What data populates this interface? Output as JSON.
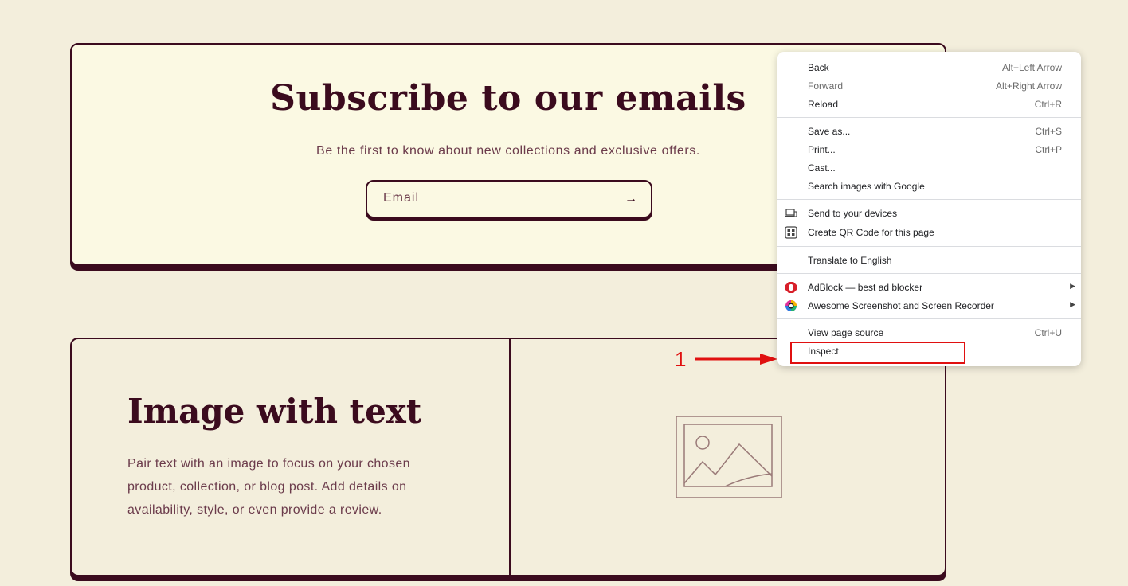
{
  "subscribe": {
    "title": "Subscribe to our emails",
    "subtitle": "Be the first to know about new collections and exclusive offers.",
    "email_placeholder": "Email",
    "submit_icon": "→"
  },
  "image_with_text": {
    "title": "Image with text",
    "body": "Pair text with an image to focus on your chosen product, collection, or blog post. Add details on availability, style, or even provide a review.",
    "image_icon": "image-placeholder-icon"
  },
  "annotation": {
    "number": "1",
    "color": "#e01010"
  },
  "context_menu": {
    "items": [
      {
        "label": "Back",
        "shortcut": "Alt+Left Arrow"
      },
      {
        "label": "Forward",
        "shortcut": "Alt+Right Arrow"
      },
      {
        "label": "Reload",
        "shortcut": "Ctrl+R"
      },
      {
        "label": "Save as...",
        "shortcut": "Ctrl+S"
      },
      {
        "label": "Print...",
        "shortcut": "Ctrl+P"
      },
      {
        "label": "Cast..."
      },
      {
        "label": "Search images with Google"
      },
      {
        "label": "Send to your devices",
        "icon": "devices-icon"
      },
      {
        "label": "Create QR Code for this page",
        "icon": "qr-code-icon"
      },
      {
        "label": "Translate to English"
      },
      {
        "label": "AdBlock — best ad blocker",
        "icon": "adblock-icon",
        "submenu": "▶"
      },
      {
        "label": "Awesome Screenshot and Screen Recorder",
        "icon": "awesome-screenshot-icon",
        "submenu": "▶"
      },
      {
        "label": "View page source",
        "shortcut": "Ctrl+U"
      },
      {
        "label": "Inspect"
      }
    ]
  },
  "colors": {
    "page_bg": "#f3eedc",
    "card_bg": "#fbf9e3",
    "brand": "#3b0b1e",
    "text_muted": "#6b3b4b"
  }
}
